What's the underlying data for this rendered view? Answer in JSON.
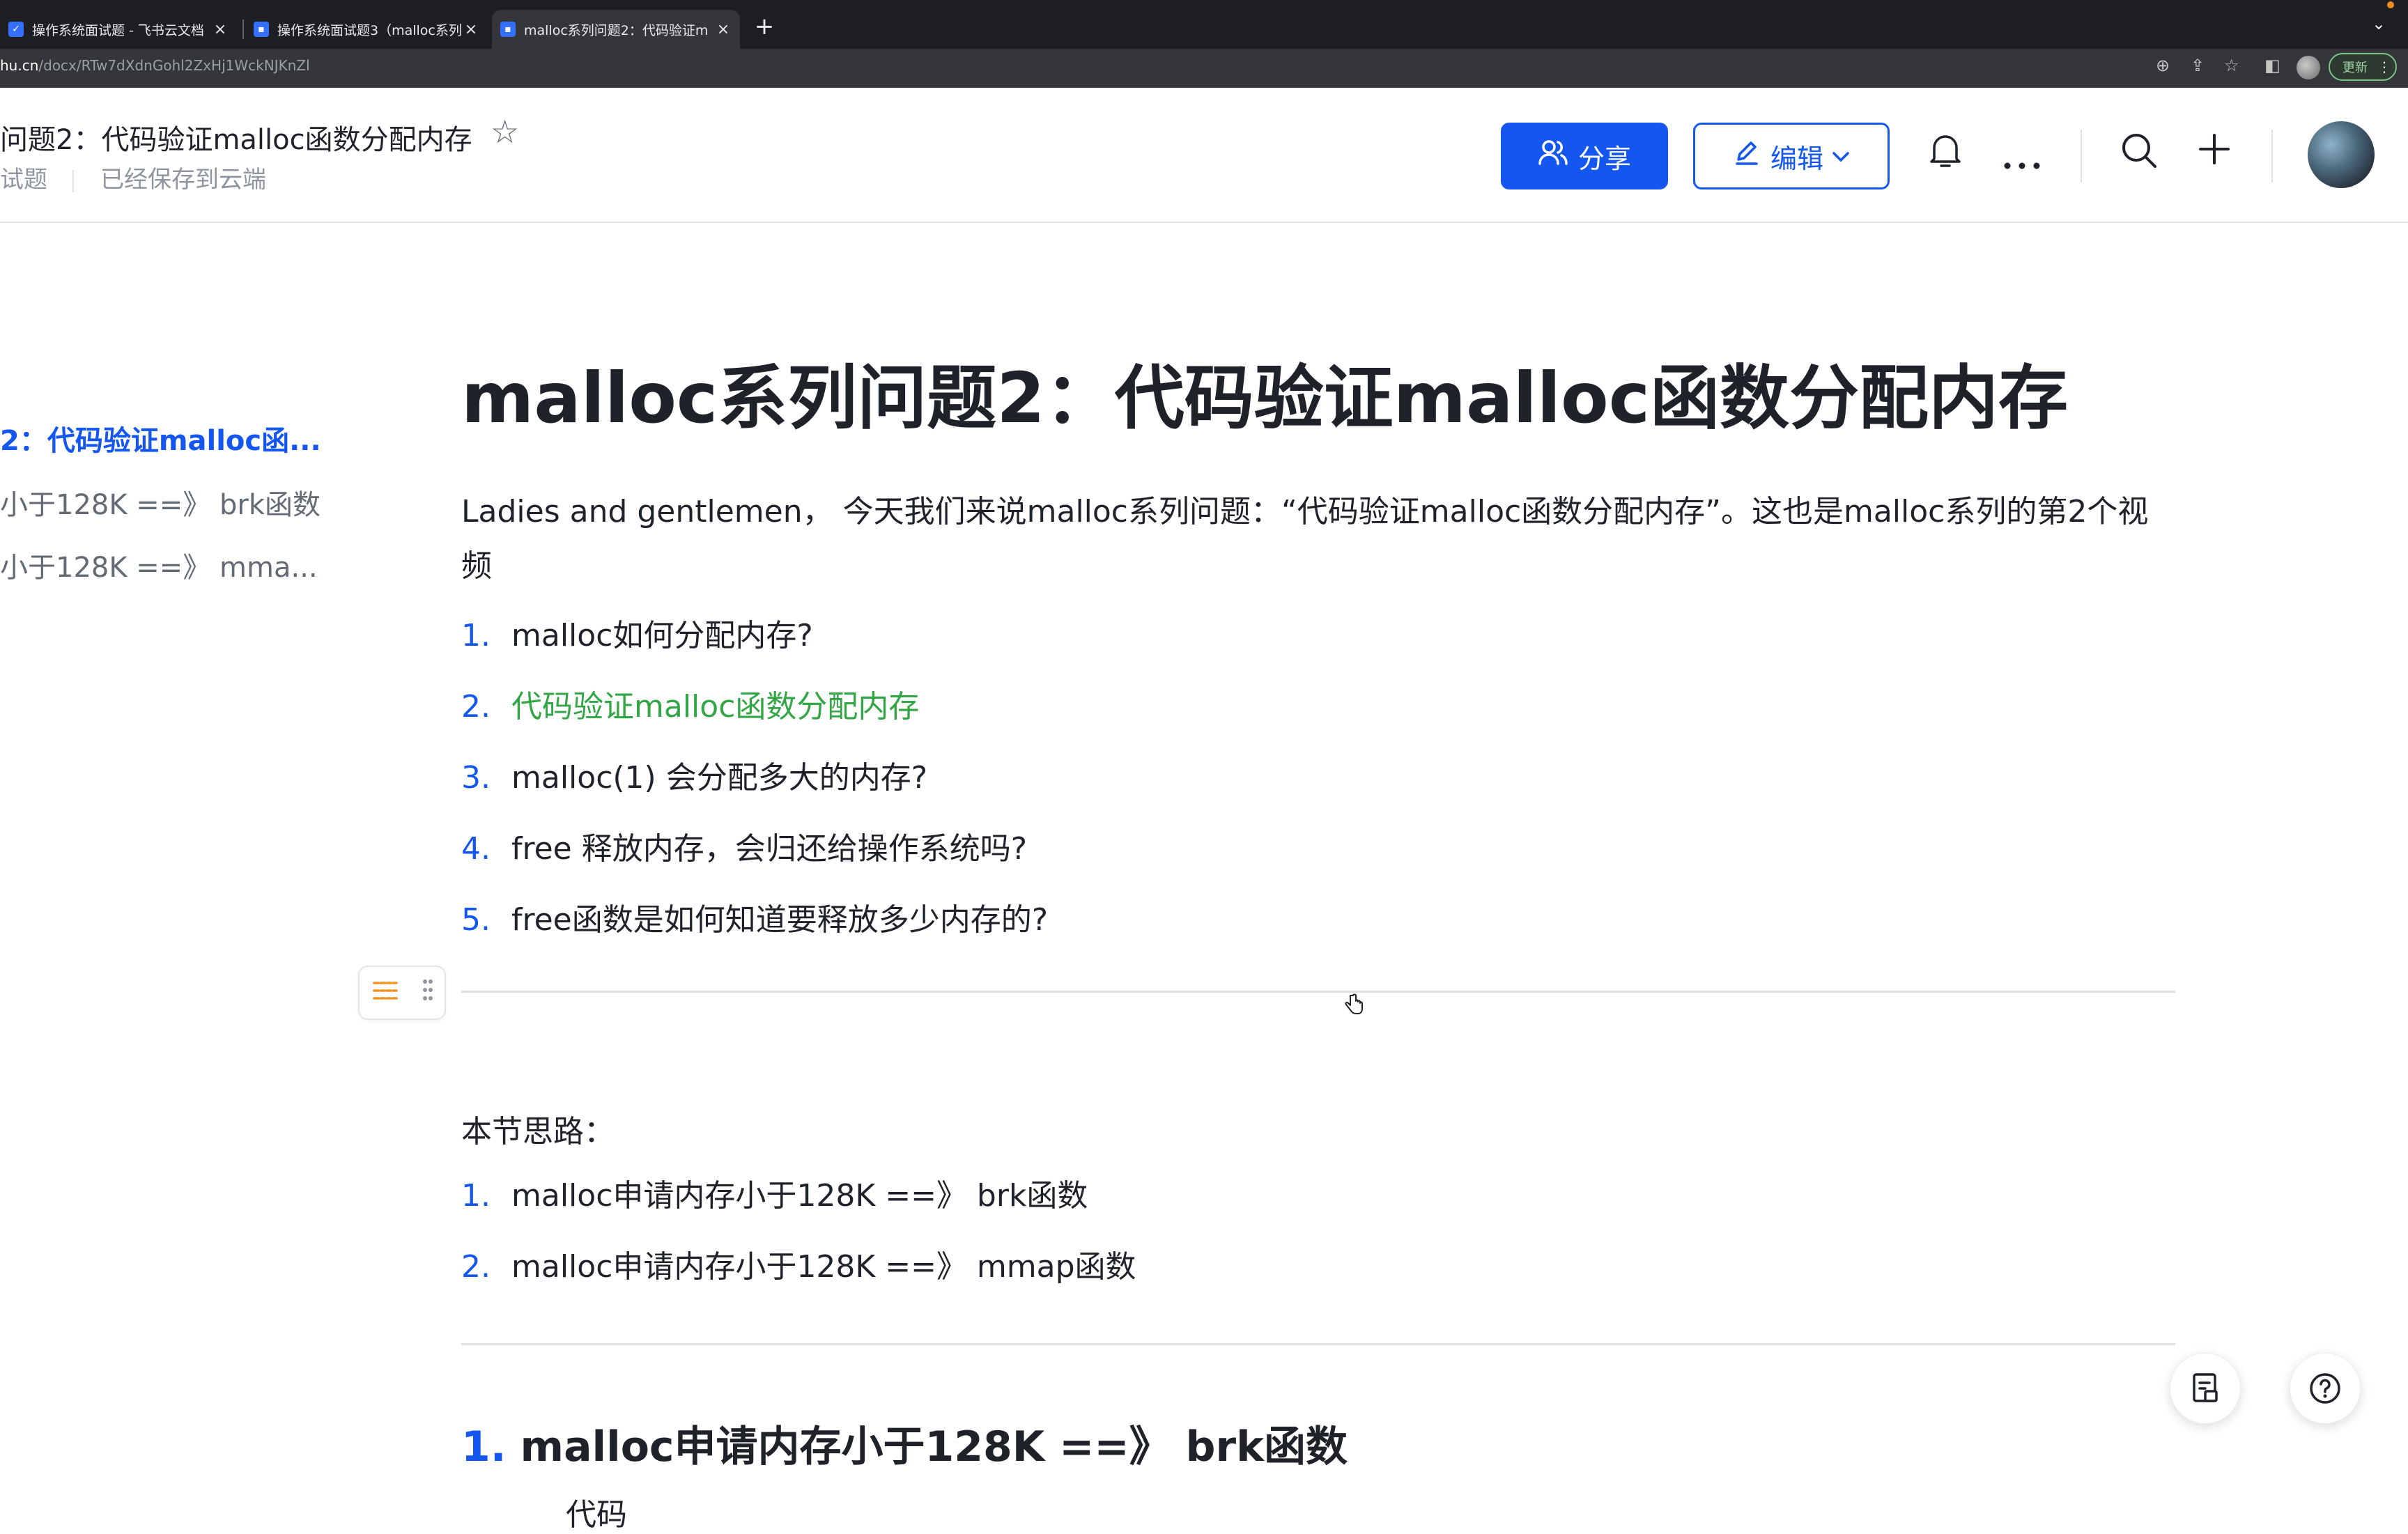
{
  "browser": {
    "tabs": [
      {
        "title": "操作系统面试题 - 飞书云文档",
        "close": "×",
        "active": false
      },
      {
        "title": "操作系统面试题3（malloc系列",
        "close": "×",
        "active": false
      },
      {
        "title": "malloc系列问题2：代码验证m",
        "close": "×",
        "active": true
      }
    ],
    "new_tab": "+",
    "tab_menu": "⌄",
    "url_host": "hu.cn",
    "url_path": "/docx/RTw7dXdnGohl2ZxHj1WckNJKnZl",
    "update_label": "更新",
    "more": "⋮"
  },
  "header": {
    "doc_title": "问题2：代码验证malloc函数分配内存",
    "breadcrumb_parent": "试题",
    "save_status": "已经保存到云端",
    "share_label": "分享",
    "edit_label": "编辑"
  },
  "toc": {
    "items": [
      "2：代码验证malloc函...",
      "小于128K ==》 brk函数",
      "小于128K ==》 mma..."
    ]
  },
  "doc": {
    "title": "malloc系列问题2：代码验证malloc函数分配内存",
    "intro": "Ladies and gentlemen， 今天我们来说malloc系列问题：“代码验证malloc函数分配内存”。这也是malloc系列的第2个视频",
    "series_list": [
      {
        "num": "1.",
        "text": "malloc如何分配内存?"
      },
      {
        "num": "2.",
        "text": "代码验证malloc函数分配内存"
      },
      {
        "num": "3.",
        "text": "malloc(1) 会分配多大的内存?"
      },
      {
        "num": "4.",
        "text": "free 释放内存，会归还给操作系统吗?"
      },
      {
        "num": "5.",
        "text": "free函数是如何知道要释放多少内存的?"
      }
    ],
    "section_intro": "本节思路：",
    "plan_list": [
      {
        "num": "1.",
        "text": "malloc申请内存小于128K ==》 brk函数"
      },
      {
        "num": "2.",
        "text": "malloc申请内存小于128K ==》 mmap函数"
      }
    ],
    "h2_num": "1.",
    "h2_text": "malloc申请内存小于128K ==》 brk函数",
    "cut_text": "代码"
  },
  "icons": {
    "star": "star-outline-icon",
    "share": "people-icon",
    "edit": "pencil-icon",
    "bell": "bell-icon",
    "more": "ellipsis-icon",
    "search": "search-icon",
    "plus": "plus-icon",
    "block_type": "list-lines-icon",
    "grip": "drag-handle-icon",
    "outline_panel": "document-outline-icon",
    "help": "help-circle-icon"
  },
  "colors": {
    "brand_blue": "#1456f0",
    "highlight_green": "#32a645",
    "text": "#1f2329",
    "muted": "#8f959e"
  }
}
